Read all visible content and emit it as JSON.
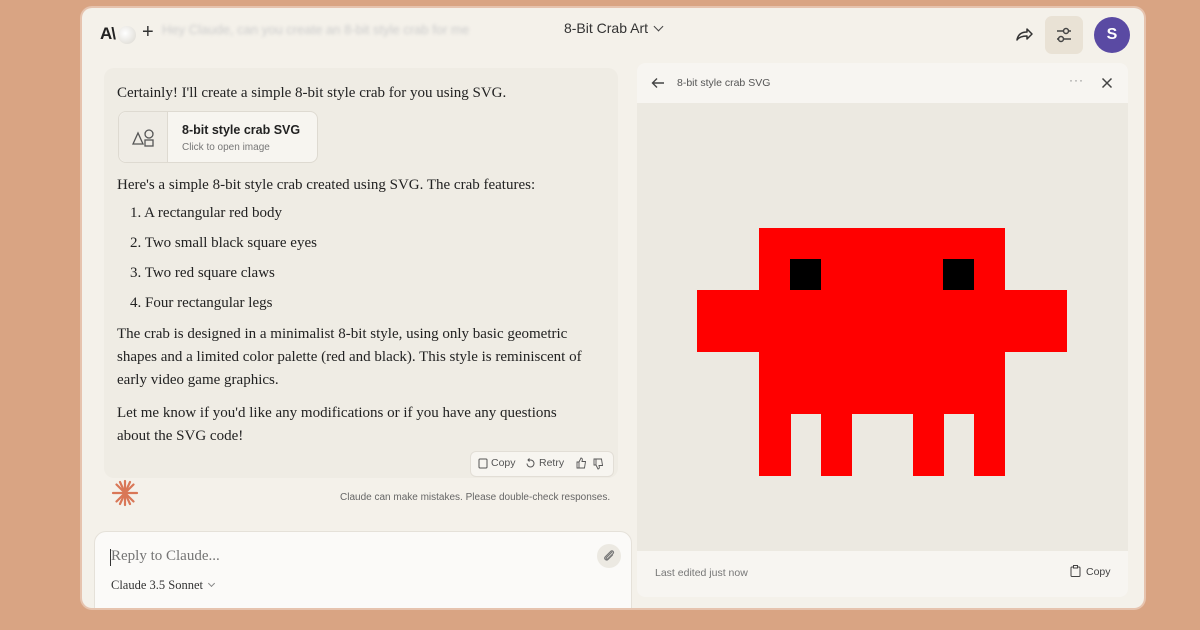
{
  "header": {
    "logo_text": "A\\",
    "conversation_title": "8-Bit Crab Art",
    "ghost_prompt": "Hey Claude, can you create an 8-bit style crab for me",
    "avatar_initial": "S"
  },
  "message": {
    "intro": "Certainly! I'll create a simple 8-bit style crab for you using SVG.",
    "artifact_card": {
      "title": "8-bit style crab SVG",
      "subtitle": "Click to open image"
    },
    "paragraph1": "Here's a simple 8-bit style crab created using SVG. The crab features:",
    "features": [
      "1. A rectangular red body",
      "2. Two small black square eyes",
      "3. Two red square claws",
      "4. Four rectangular legs"
    ],
    "paragraph2": "The crab is designed in a minimalist 8-bit style, using only basic geometric shapes and a limited color palette (red and black). This style is reminiscent of early video game graphics.",
    "paragraph3": "Let me know if you'd like any modifications or if you have any questions about the SVG code!",
    "actions": {
      "copy": "Copy",
      "retry": "Retry"
    },
    "disclaimer": "Claude can make mistakes. Please double-check responses."
  },
  "input": {
    "placeholder": "Reply to Claude...",
    "model": "Claude 3.5 Sonnet"
  },
  "artifact_panel": {
    "title": "8-bit style crab SVG",
    "footer_status": "Last edited just now",
    "copy_label": "Copy"
  },
  "colors": {
    "crab_red": "#ff0000",
    "crab_eye": "#000000",
    "accent_orange": "#d97757",
    "avatar_bg": "#5a4aa3"
  }
}
